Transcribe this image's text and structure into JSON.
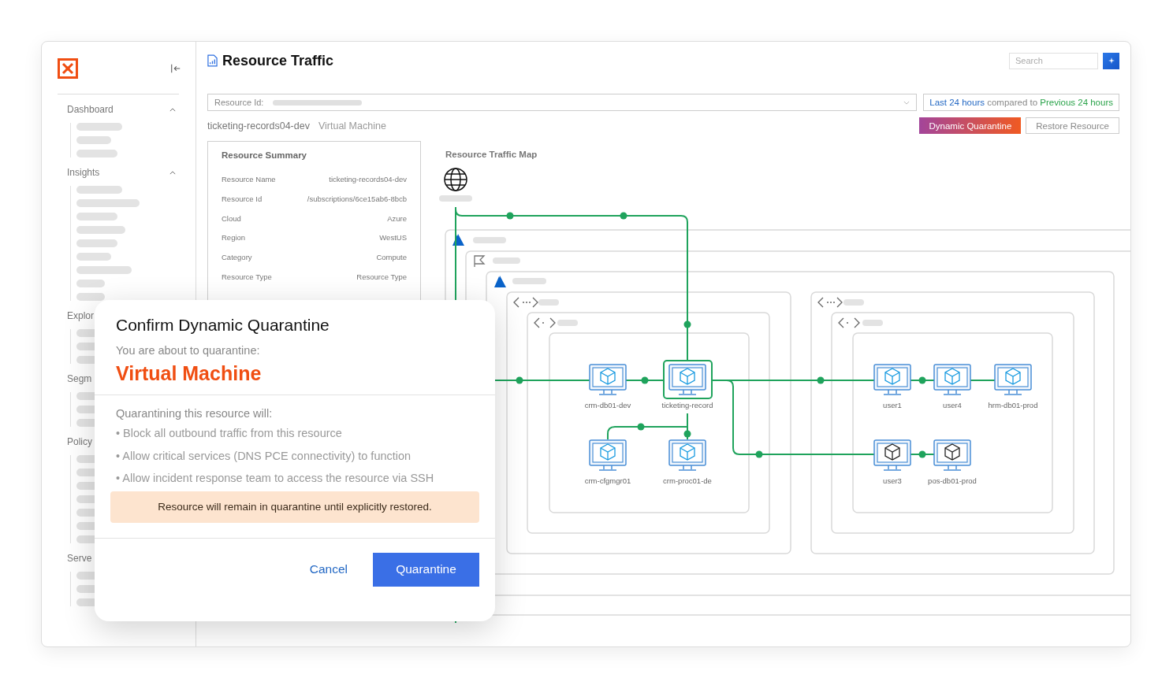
{
  "sidebar": {
    "sections": [
      {
        "label": "Dashboard",
        "expanded": true
      },
      {
        "label": "Insights",
        "expanded": true
      },
      {
        "label": "Explor"
      },
      {
        "label": "Segm"
      },
      {
        "label": "Policy"
      },
      {
        "label": "Serve"
      }
    ]
  },
  "header": {
    "title": "Resource Traffic",
    "search": {
      "placeholder": "Search"
    }
  },
  "filter": {
    "label": "Resource Id:",
    "time_range": {
      "current": "Last 24 hours",
      "joiner": "compared to",
      "previous": "Previous 24 hours"
    }
  },
  "resource": {
    "name": "ticketing-records04-dev",
    "type": "Virtual Machine"
  },
  "actions": [
    {
      "label": "Dynamic Quarantine",
      "kind": "primary"
    },
    {
      "label": "Restore Resource",
      "kind": "secondary"
    }
  ],
  "summary": {
    "title": "Resource Summary",
    "rows": [
      {
        "label": "Resource Name",
        "value": "ticketing-records04-dev"
      },
      {
        "label": "Resource Id",
        "value": "/subscriptions/6ce15ab6-8bcb"
      },
      {
        "label": "Cloud",
        "value": "Azure"
      },
      {
        "label": "Region",
        "value": "WestUS"
      },
      {
        "label": "Category",
        "value": "Compute"
      },
      {
        "label": "Resource Type",
        "value": "Resource Type"
      }
    ]
  },
  "map": {
    "title": "Resource Traffic Map",
    "nodes": [
      {
        "label": "crm-db01-dev",
        "selected": false,
        "color": "#1a9be0"
      },
      {
        "label": "ticketing-record",
        "selected": true,
        "color": "#1a9be0"
      },
      {
        "label": "user1",
        "selected": false,
        "color": "#1a9be0"
      },
      {
        "label": "user4",
        "selected": false,
        "color": "#1a9be0"
      },
      {
        "label": "hrm-db01-prod",
        "selected": false,
        "color": "#1a9be0"
      },
      {
        "label": "crm-cfgmgr01",
        "selected": false,
        "color": "#1a9be0"
      },
      {
        "label": "crm-proc01-de",
        "selected": false,
        "color": "#1a9be0"
      },
      {
        "label": "user3",
        "selected": false,
        "color": "#222222"
      },
      {
        "label": "pos-db01-prod",
        "selected": false,
        "color": "#222222"
      }
    ]
  },
  "dialog": {
    "title": "Confirm Dynamic Quarantine",
    "intro": "You are about to quarantine:",
    "target": "Virtual Machine",
    "effects_title": "Quarantining this resource will:",
    "effects": [
      "• Block all outbound traffic from this resource",
      "• Allow critical services (DNS PCE connectivity) to function",
      "• Allow incident response team to access the resource via SSH"
    ],
    "notice": "Resource will remain in quarantine until explicitly restored.",
    "buttons": [
      {
        "label": "Cancel",
        "kind": "link"
      },
      {
        "label": "Quarantine",
        "kind": "primary"
      }
    ]
  }
}
